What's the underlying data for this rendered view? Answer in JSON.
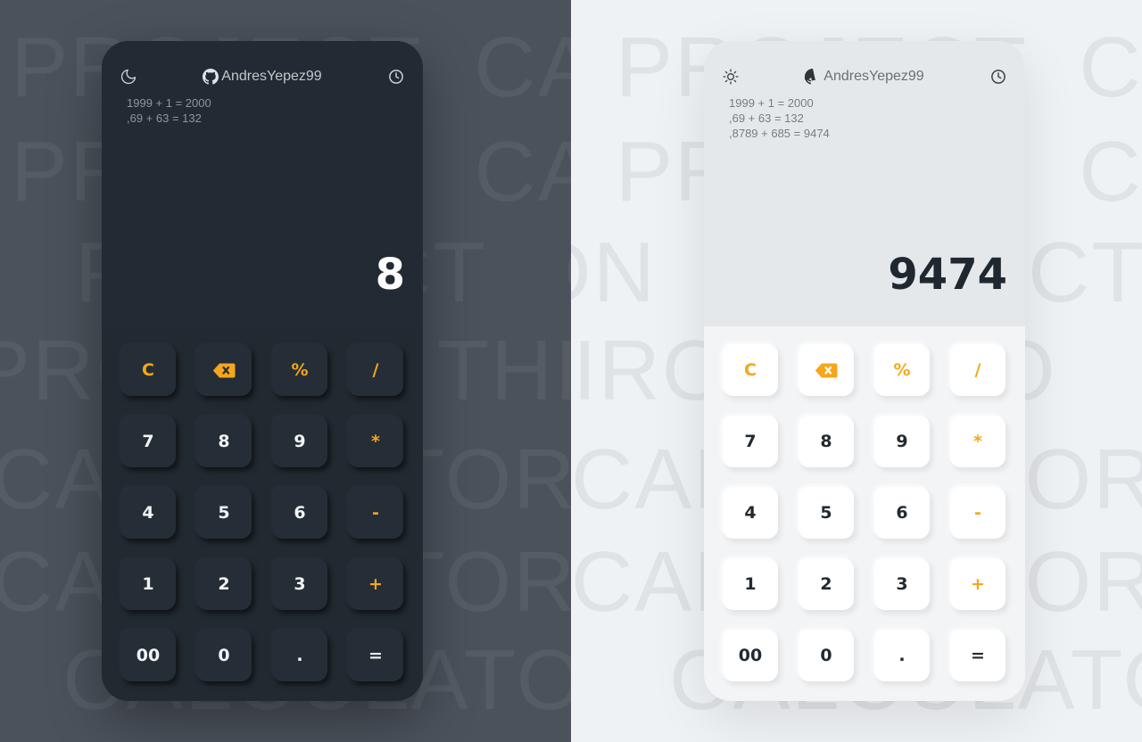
{
  "background_words": [
    "PROJECT",
    "CALCULATOR",
    "THIRO",
    "CALCULATOR",
    "ON",
    "PROJECT"
  ],
  "dark": {
    "theme_icon": "moon-icon",
    "brand": "AndresYepez99",
    "history": [
      "1999 + 1 = 2000",
      ",69 + 63 = 132"
    ],
    "result": "8",
    "keys": [
      [
        "C",
        "backspace",
        "%",
        "/"
      ],
      [
        "7",
        "8",
        "9",
        "*"
      ],
      [
        "4",
        "5",
        "6",
        "-"
      ],
      [
        "1",
        "2",
        "3",
        "+"
      ],
      [
        "00",
        "0",
        ".",
        "="
      ]
    ]
  },
  "light": {
    "theme_icon": "sun-icon",
    "brand": "AndresYepez99",
    "history": [
      "1999 + 1 = 2000",
      ",69 + 63 = 132",
      ",8789 + 685 = 9474"
    ],
    "result": "9474",
    "keys": [
      [
        "C",
        "backspace",
        "%",
        "/"
      ],
      [
        "7",
        "8",
        "9",
        "*"
      ],
      [
        "4",
        "5",
        "6",
        "-"
      ],
      [
        "1",
        "2",
        "3",
        "+"
      ],
      [
        "00",
        "0",
        ".",
        "="
      ]
    ]
  },
  "colors": {
    "accent": "#f6a61b",
    "dark_bg": "#4b525b",
    "dark_panel": "#212a31",
    "light_bg": "#eff2f5",
    "light_panel": "#f2f4f6"
  }
}
